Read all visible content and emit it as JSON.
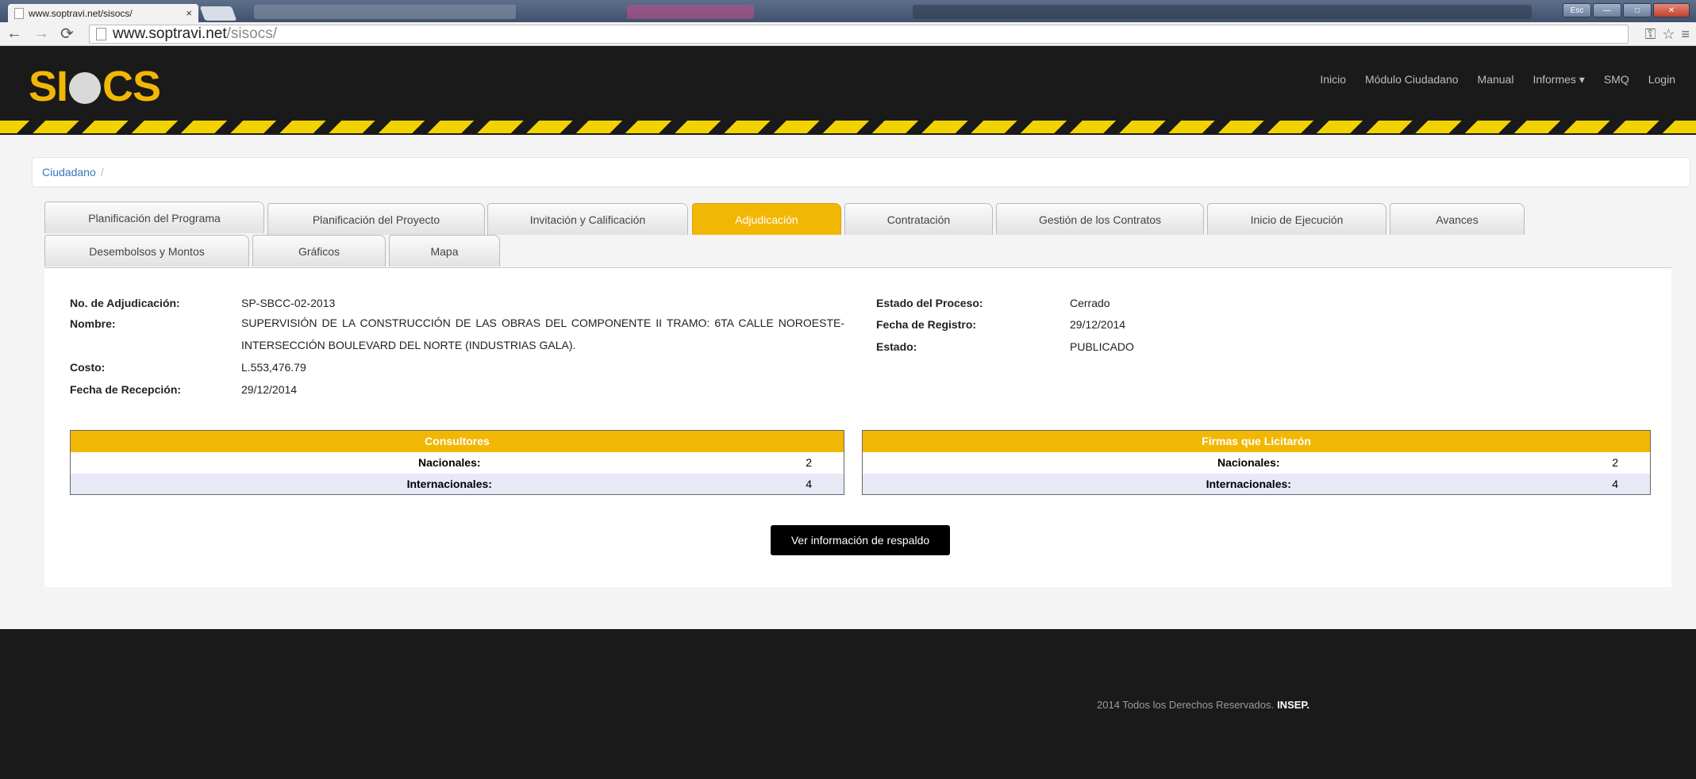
{
  "browser": {
    "tab_title": "www.soptravi.net/sisocs/",
    "tab_close": "×",
    "url_host": "www.soptravi.net",
    "url_path": "/sisocs/",
    "win_label": "Esc",
    "win_min": "—",
    "win_max": "□",
    "win_close": "✕"
  },
  "header": {
    "logo_left": "SI",
    "logo_right": "CS",
    "nav": [
      "Inicio",
      "Módulo Ciudadano",
      "Manual",
      "Informes ▾",
      "SMQ",
      "Login"
    ]
  },
  "breadcrumb": {
    "item": "Ciudadano",
    "separator": "/"
  },
  "tabs": {
    "row1": [
      "Planificación del Programa",
      "Planificación del Proyecto",
      "Invitación y Calificación",
      "Adjudicación",
      "Contratación",
      "Gestión de los Contratos",
      "Inicio de Ejecución",
      "Avances"
    ],
    "row2": [
      "Desembolsos y Montos",
      "Gráficos",
      "Mapa"
    ],
    "active": "Adjudicación"
  },
  "details": {
    "numero_label": "No. de Adjudicación:",
    "numero_value": "SP-SBCC-02-2013",
    "nombre_label": "Nombre:",
    "nombre_value": "SUPERVISIÓN DE LA CONSTRUCCIÓN DE LAS OBRAS DEL COMPONENTE II TRAMO: 6TA CALLE NOROESTE-INTERSECCIÓN BOULEVARD DEL NORTE (INDUSTRIAS GALA).",
    "costo_label": "Costo:",
    "costo_value": "L.553,476.79",
    "recepcion_label": "Fecha de Recepción:",
    "recepcion_value": "29/12/2014",
    "estado_proceso_label": "Estado del Proceso:",
    "estado_proceso_value": "Cerrado",
    "registro_label": "Fecha de Registro:",
    "registro_value": "29/12/2014",
    "estado_label": "Estado:",
    "estado_value": "PUBLICADO"
  },
  "consultores": {
    "title": "Consultores",
    "rows": [
      {
        "label": "Nacionales:",
        "value": "2"
      },
      {
        "label": "Internacionales:",
        "value": "4"
      }
    ]
  },
  "firmas": {
    "title": "Firmas que Licitarón",
    "rows": [
      {
        "label": "Nacionales:",
        "value": "2"
      },
      {
        "label": "Internacionales:",
        "value": "4"
      }
    ]
  },
  "action_label": "Ver información de respaldo",
  "footer": {
    "text": "2014 Todos los Derechos Reservados.",
    "brand": "INSEP."
  },
  "colors": {
    "accent": "#f2b705",
    "header_bg": "#1a1a1a",
    "link": "#3479b8"
  }
}
